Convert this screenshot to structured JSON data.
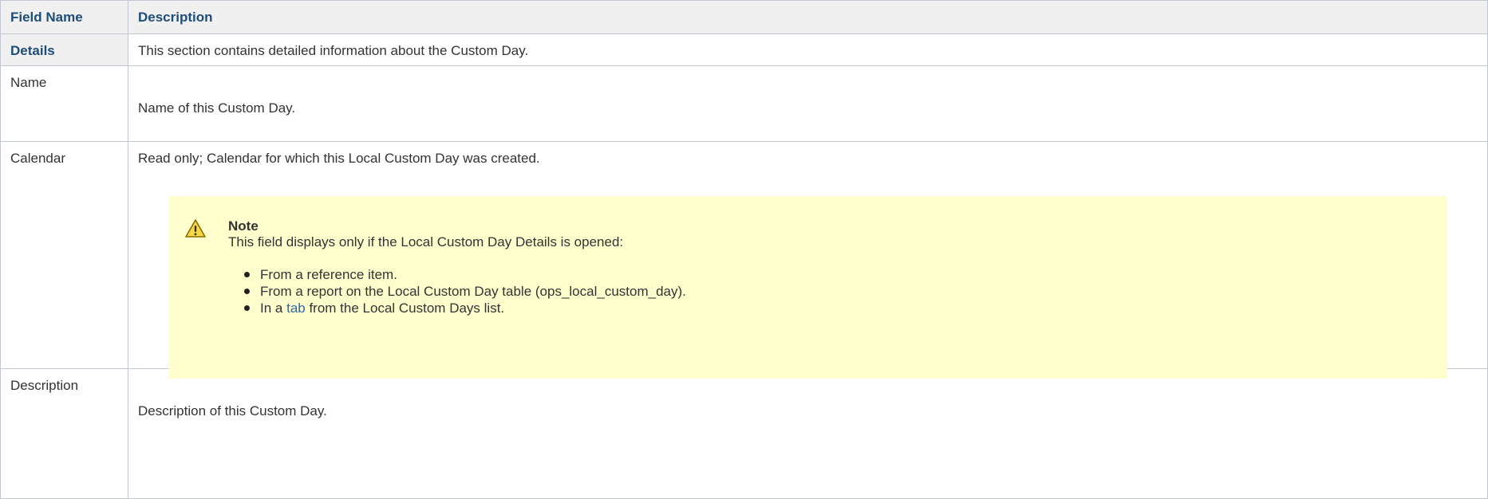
{
  "table": {
    "header": {
      "field_name": "Field Name",
      "description": "Description"
    },
    "rows": [
      {
        "field": "Details",
        "description": "This section contains detailed information about the Custom Day."
      },
      {
        "field": "Name",
        "description": "Name of this Custom Day."
      },
      {
        "field": "Calendar",
        "description": "Read only; Calendar for which this Local Custom Day was created.",
        "note": {
          "icon": "warning-icon",
          "title": "Note",
          "text": "This field displays only if the Local Custom Day Details is opened:",
          "bullets": [
            "From a reference item.",
            "From a report on the Local Custom Day table (ops_local_custom_day)."
          ],
          "bullet_link": {
            "prefix": "In a ",
            "link": "tab",
            "suffix": " from the Local Custom Days list."
          }
        }
      },
      {
        "field": "Description",
        "description": "Description of this Custom Day."
      }
    ]
  },
  "colors": {
    "header_bg": "#f0f0f0",
    "header_text": "#1f4d7a",
    "note_bg": "#ffffce",
    "link": "#2a6aa8",
    "border": "#c1c7d0"
  }
}
